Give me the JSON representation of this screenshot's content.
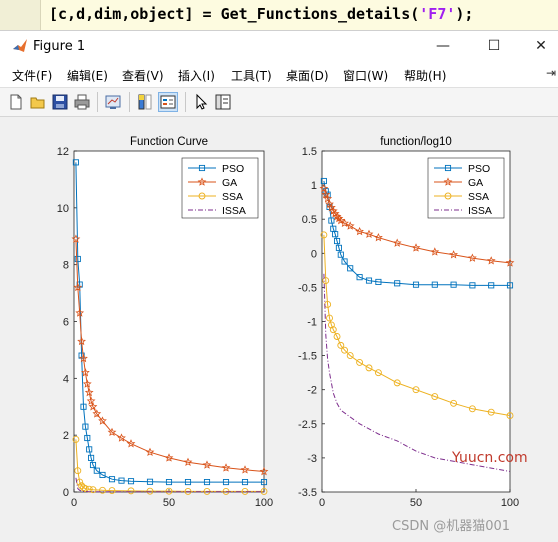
{
  "editor": {
    "code_prefix": "[c,d,dim,object] = Get_Functions_details(",
    "code_string": "'F7'",
    "code_suffix": ");"
  },
  "window": {
    "title": "Figure 1",
    "minimize_glyph": "—",
    "maximize_glyph": "☐",
    "close_glyph": "✕"
  },
  "menu": [
    "文件(F)",
    "编辑(E)",
    "查看(V)",
    "插入(I)",
    "工具(T)",
    "桌面(D)",
    "窗口(W)",
    "帮助(H)"
  ],
  "menu_more": "⇥",
  "toolbar_icons": [
    "new-figure-icon",
    "open-file-icon",
    "save-icon",
    "print-icon",
    "link-plot-icon",
    "insert-colorbar-icon",
    "insert-legend-icon",
    "pointer-icon",
    "property-editor-icon"
  ],
  "colors": {
    "PSO": "#0072bd",
    "GA": "#d95319",
    "SSA": "#edb120",
    "ISSA": "#7e2f8e"
  },
  "chart_data": [
    {
      "type": "line",
      "title": "Function Curve",
      "xlim": [
        0,
        100
      ],
      "ylim": [
        0,
        12
      ],
      "xticks": [
        0,
        50,
        100
      ],
      "yticks": [
        0,
        2,
        4,
        6,
        8,
        10,
        12
      ],
      "legend": [
        "PSO",
        "GA",
        "SSA",
        "ISSA"
      ],
      "legend_position": "top-right",
      "series": [
        {
          "name": "PSO",
          "marker": "square",
          "x": [
            1,
            2,
            3,
            4,
            5,
            6,
            7,
            8,
            9,
            10,
            12,
            15,
            20,
            25,
            30,
            40,
            50,
            60,
            70,
            80,
            90,
            100
          ],
          "y": [
            11.6,
            8.2,
            7.3,
            4.8,
            3.0,
            2.3,
            1.9,
            1.5,
            1.2,
            0.95,
            0.75,
            0.6,
            0.45,
            0.4,
            0.38,
            0.36,
            0.35,
            0.35,
            0.35,
            0.35,
            0.35,
            0.35
          ]
        },
        {
          "name": "GA",
          "marker": "star",
          "x": [
            1,
            2,
            3,
            4,
            5,
            6,
            7,
            8,
            9,
            10,
            12,
            15,
            20,
            25,
            30,
            40,
            50,
            60,
            70,
            80,
            90,
            100
          ],
          "y": [
            8.9,
            7.2,
            6.3,
            5.3,
            4.7,
            4.2,
            3.8,
            3.5,
            3.2,
            3.0,
            2.75,
            2.5,
            2.1,
            1.9,
            1.7,
            1.4,
            1.2,
            1.05,
            0.95,
            0.85,
            0.78,
            0.72
          ]
        },
        {
          "name": "SSA",
          "marker": "circle",
          "x": [
            1,
            2,
            3,
            4,
            5,
            6,
            8,
            10,
            15,
            20,
            30,
            40,
            50,
            60,
            70,
            80,
            90,
            100
          ],
          "y": [
            1.85,
            0.75,
            0.35,
            0.22,
            0.15,
            0.12,
            0.1,
            0.08,
            0.06,
            0.05,
            0.04,
            0.03,
            0.03,
            0.02,
            0.02,
            0.02,
            0.02,
            0.02
          ]
        },
        {
          "name": "ISSA",
          "marker": "none",
          "x": [
            1,
            2,
            3,
            4,
            6,
            8,
            10,
            20,
            40,
            60,
            80,
            100
          ],
          "y": [
            0.5,
            0.12,
            0.06,
            0.03,
            0.02,
            0.01,
            0.01,
            0.01,
            0.01,
            0.01,
            0.01,
            0.01
          ]
        }
      ]
    },
    {
      "type": "line",
      "title": "function/log10",
      "xlim": [
        0,
        100
      ],
      "ylim": [
        -3.5,
        1.5
      ],
      "xticks": [
        0,
        50,
        100
      ],
      "yticks": [
        -3.5,
        -3,
        -2.5,
        -2,
        -1.5,
        -1,
        -0.5,
        0,
        0.5,
        1,
        1.5
      ],
      "legend": [
        "PSO",
        "GA",
        "SSA",
        "ISSA"
      ],
      "legend_position": "top-right",
      "series": [
        {
          "name": "PSO",
          "marker": "square",
          "x": [
            1,
            2,
            3,
            4,
            5,
            6,
            7,
            8,
            9,
            10,
            12,
            15,
            20,
            25,
            30,
            40,
            50,
            60,
            70,
            80,
            90,
            100
          ],
          "y": [
            1.06,
            0.91,
            0.86,
            0.68,
            0.48,
            0.36,
            0.28,
            0.18,
            0.08,
            -0.02,
            -0.12,
            -0.22,
            -0.35,
            -0.4,
            -0.42,
            -0.44,
            -0.46,
            -0.46,
            -0.46,
            -0.47,
            -0.47,
            -0.47
          ]
        },
        {
          "name": "GA",
          "marker": "star",
          "x": [
            1,
            2,
            3,
            4,
            5,
            6,
            7,
            8,
            9,
            10,
            12,
            15,
            20,
            25,
            30,
            40,
            50,
            60,
            70,
            80,
            90,
            100
          ],
          "y": [
            0.95,
            0.86,
            0.8,
            0.72,
            0.67,
            0.62,
            0.58,
            0.54,
            0.51,
            0.48,
            0.44,
            0.4,
            0.32,
            0.28,
            0.23,
            0.15,
            0.08,
            0.02,
            -0.02,
            -0.07,
            -0.11,
            -0.14
          ]
        },
        {
          "name": "SSA",
          "marker": "circle",
          "x": [
            1,
            2,
            3,
            4,
            5,
            6,
            8,
            10,
            12,
            15,
            20,
            25,
            30,
            40,
            50,
            60,
            70,
            80,
            90,
            100
          ],
          "y": [
            0.27,
            -0.4,
            -0.75,
            -0.95,
            -1.05,
            -1.12,
            -1.22,
            -1.35,
            -1.42,
            -1.5,
            -1.6,
            -1.68,
            -1.75,
            -1.9,
            -2.0,
            -2.1,
            -2.2,
            -2.28,
            -2.33,
            -2.38
          ]
        },
        {
          "name": "ISSA",
          "marker": "none",
          "x": [
            1,
            2,
            3,
            4,
            5,
            6,
            8,
            10,
            15,
            20,
            30,
            40,
            50,
            60,
            70,
            80,
            90,
            100
          ],
          "y": [
            -0.3,
            -1.2,
            -1.55,
            -1.75,
            -1.9,
            -2.05,
            -2.2,
            -2.3,
            -2.4,
            -2.5,
            -2.65,
            -2.75,
            -2.9,
            -3.0,
            -3.05,
            -3.1,
            -3.15,
            -3.2
          ]
        }
      ]
    }
  ],
  "watermarks": {
    "yuucn": "Yuucn.com",
    "csdn": "CSDN @机器猫001"
  }
}
